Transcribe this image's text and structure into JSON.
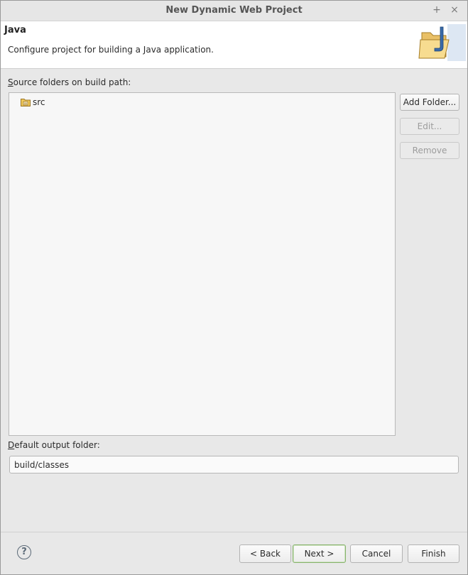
{
  "window": {
    "title": "New Dynamic Web Project",
    "maximize_glyph": "+",
    "close_glyph": "×"
  },
  "banner": {
    "title": "Java",
    "description": "Configure project for building a Java application.",
    "icon": "java-folder-icon"
  },
  "source": {
    "label": "Source folders on build path:",
    "label_mnemonic": "S",
    "label_rest": "ource folders on build path:",
    "items": [
      {
        "label": "src",
        "icon": "source-folder-icon"
      }
    ],
    "buttons": {
      "add_folder": "Add Folder...",
      "edit": "Edit...",
      "remove": "Remove"
    }
  },
  "output": {
    "label": "Default output folder:",
    "label_mnemonic": "D",
    "label_rest": "efault output folder:",
    "value": "build/classes"
  },
  "footer": {
    "help": "?",
    "back": "< Back",
    "next": "Next >",
    "cancel": "Cancel",
    "finish": "Finish"
  },
  "colors": {
    "default_button_border": "#86b36c",
    "folder_yellow": "#f0c95a"
  }
}
